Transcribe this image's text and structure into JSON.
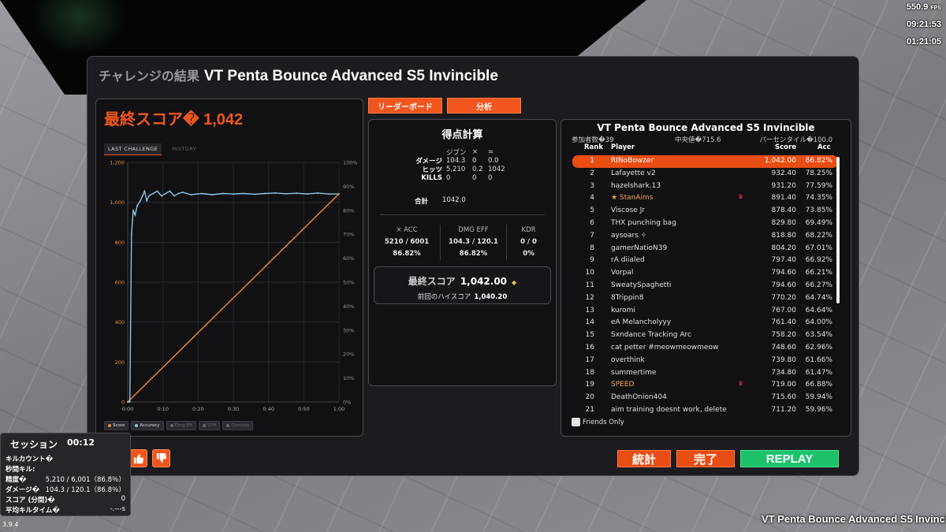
{
  "hud": {
    "fps": "550.9",
    "fps_unit": "FPS",
    "time1": "09:21:53",
    "time2": "01:21:05"
  },
  "panel": {
    "title_ja": "チャレンジの結果",
    "title_name": "VT Penta Bounce Advanced S5 Invincible",
    "final_score_label": "最終スコア�",
    "final_score_value": "1,042"
  },
  "tabs": {
    "leaderboard": "リーダーボード",
    "analysis": "分析"
  },
  "chart_tabs": {
    "last": "LAST CHALLENGE",
    "history": "HISTORY"
  },
  "chart_data": {
    "type": "line",
    "x": [
      0,
      5,
      8,
      10,
      12,
      15,
      18,
      20,
      22,
      25,
      30,
      35,
      40,
      45,
      50,
      55,
      60,
      65,
      70,
      75,
      80,
      85,
      90,
      95,
      100
    ],
    "xlabel": "",
    "x_ticks": [
      "0:00",
      "0:10",
      "0:20",
      "0:30",
      "0:40",
      "0:50",
      "1:00"
    ],
    "ylim": [
      0,
      1200
    ],
    "y_ticks": [
      "0",
      "200",
      "400",
      "600",
      "800",
      "1,000",
      "1,200"
    ],
    "y2lim": [
      0,
      100
    ],
    "y2_ticks": [
      "0%",
      "10%",
      "20%",
      "30%",
      "40%",
      "50%",
      "60%",
      "70%",
      "80%",
      "90%",
      "100%"
    ],
    "series": [
      {
        "name": "Score",
        "axis": "left",
        "color": "#f28a2e",
        "points": [
          [
            0,
            0
          ],
          [
            100,
            1042
          ]
        ]
      },
      {
        "name": "Accuracy",
        "axis": "right",
        "color": "#8fc4e8",
        "points": [
          [
            0,
            0
          ],
          [
            1,
            0
          ],
          [
            1.8,
            70
          ],
          [
            2.6,
            80
          ],
          [
            3.5,
            78
          ],
          [
            4.5,
            82
          ],
          [
            6,
            84
          ],
          [
            7,
            86
          ],
          [
            8,
            88
          ],
          [
            9,
            84
          ],
          [
            10,
            86
          ],
          [
            12,
            87
          ],
          [
            14,
            88
          ],
          [
            16,
            86
          ],
          [
            18,
            87
          ],
          [
            20,
            88
          ],
          [
            22,
            86
          ],
          [
            24,
            87
          ],
          [
            26,
            87.5
          ],
          [
            30,
            86.5
          ],
          [
            35,
            87
          ],
          [
            40,
            86.5
          ],
          [
            45,
            87
          ],
          [
            50,
            86.8
          ],
          [
            55,
            87
          ],
          [
            60,
            86.7
          ],
          [
            65,
            87
          ],
          [
            70,
            87.2
          ],
          [
            75,
            86.9
          ],
          [
            80,
            87.1
          ],
          [
            85,
            86.8
          ],
          [
            90,
            87.2
          ],
          [
            95,
            86.8
          ],
          [
            100,
            86.8
          ]
        ]
      }
    ],
    "legend": [
      {
        "label": "Score",
        "active": true,
        "color": "#f28a2e"
      },
      {
        "label": "Accuracy",
        "active": true,
        "color": "#8fc4e8"
      },
      {
        "label": "Dmg Eff",
        "active": false,
        "color": "#6a6a70"
      },
      {
        "label": "SPM",
        "active": false,
        "color": "#6a6a70"
      },
      {
        "label": "Damage",
        "active": false,
        "color": "#6a6a70"
      }
    ]
  },
  "calc": {
    "title": "得点計算",
    "header": [
      "",
      "ジブン",
      "×",
      "="
    ],
    "rows": [
      [
        "ダメージ",
        "104.3",
        "0",
        "0.0"
      ],
      [
        "ヒッツ",
        "5,210",
        "0.2",
        "1042"
      ],
      [
        "KILLS",
        "0",
        "0",
        "0"
      ]
    ],
    "total_label": "合計",
    "total_value": "1042.0",
    "stats": [
      {
        "h": "× ACC",
        "v1": "5210 / 6001",
        "v2": "86.82%"
      },
      {
        "h": "DMG EFF",
        "v1": "104.3 / 120.1",
        "v2": "86.82%"
      },
      {
        "h": "KDR",
        "v1": "0 / 0",
        "v2": "0%"
      }
    ],
    "final_label": "最終スコア",
    "final_value": "1,042.00",
    "prev_label": "前回のハイスコア",
    "prev_value": "1,040.20"
  },
  "leaderboard": {
    "title": "VT Penta Bounce Advanced S5 Invincible",
    "participants": "参加者数�39",
    "median": "中央値�715.6",
    "percentile": "パーセンタイル�100.0",
    "headers": {
      "rank": "Rank",
      "player": "Player",
      "score": "Score",
      "acc": "Acc"
    },
    "rows": [
      {
        "rank": "1",
        "name": "RINoBowzer",
        "score": "1,042.00",
        "acc": "86.82%",
        "me": true
      },
      {
        "rank": "2",
        "name": "Lafayette v2",
        "score": "932.40",
        "acc": "78.25%"
      },
      {
        "rank": "3",
        "name": "hazelshark.13",
        "score": "931.20",
        "acc": "77.59%"
      },
      {
        "rank": "4",
        "name": "★ StanAims",
        "score": "891.40",
        "acc": "74.35%",
        "gold": true,
        "badge": true
      },
      {
        "rank": "5",
        "name": "Viscose Jr",
        "score": "878.40",
        "acc": "73.85%"
      },
      {
        "rank": "6",
        "name": "THX punching bag",
        "score": "829.80",
        "acc": "69.49%"
      },
      {
        "rank": "7",
        "name": "aysoars ✧",
        "score": "818.80",
        "acc": "68.22%"
      },
      {
        "rank": "8",
        "name": "gamerNatioN39",
        "score": "804.20",
        "acc": "67.01%"
      },
      {
        "rank": "9",
        "name": "rA diialed",
        "score": "797.40",
        "acc": "66.92%"
      },
      {
        "rank": "10",
        "name": "Vorpal",
        "score": "794.60",
        "acc": "66.21%"
      },
      {
        "rank": "11",
        "name": "SweatySpaghetti",
        "score": "794.60",
        "acc": "66.27%"
      },
      {
        "rank": "12",
        "name": "8Trippin8",
        "score": "770.20",
        "acc": "64.74%"
      },
      {
        "rank": "13",
        "name": "kuromi",
        "score": "767.00",
        "acc": "64.64%"
      },
      {
        "rank": "14",
        "name": "eA Melancholyyy",
        "score": "761.40",
        "acc": "64.00%"
      },
      {
        "rank": "15",
        "name": "Sxndance Tracking Arc",
        "score": "758.20",
        "acc": "63.54%"
      },
      {
        "rank": "16",
        "name": "cat petter #meowmeowmeow",
        "score": "748.60",
        "acc": "62.96%"
      },
      {
        "rank": "17",
        "name": "overthink",
        "score": "739.80",
        "acc": "61.66%"
      },
      {
        "rank": "18",
        "name": "summertime",
        "score": "734.80",
        "acc": "61.47%"
      },
      {
        "rank": "19",
        "name": "SPEED",
        "score": "719.00",
        "acc": "66.88%",
        "gold": true,
        "badge": true
      },
      {
        "rank": "20",
        "name": "DeathOnion404",
        "score": "715.60",
        "acc": "59.94%"
      },
      {
        "rank": "21",
        "name": "aim training doesnt work, delete",
        "score": "711.20",
        "acc": "59.96%"
      }
    ],
    "friends_only": "Friends Only"
  },
  "actions": {
    "stats": "統計",
    "done": "完了",
    "replay": "REPLAY"
  },
  "session": {
    "title": "セッション",
    "time": "00:12",
    "rows": [
      {
        "k": "キルカウント�",
        "v": ""
      },
      {
        "k": "秒間キル:",
        "v": ""
      },
      {
        "k": "精度�",
        "v": "5,210 / 6,001（86.8％）"
      },
      {
        "k": "ダメージ�",
        "v": "104.3 / 120.1（86.8％）"
      },
      {
        "k": "スコア (分間)�",
        "v": "0"
      },
      {
        "k": "平均キルタイム�",
        "v": "-.---s"
      }
    ]
  },
  "version": "3.9.4",
  "bottom_title": "VT Penta Bounce Advanced S5 Invinci"
}
